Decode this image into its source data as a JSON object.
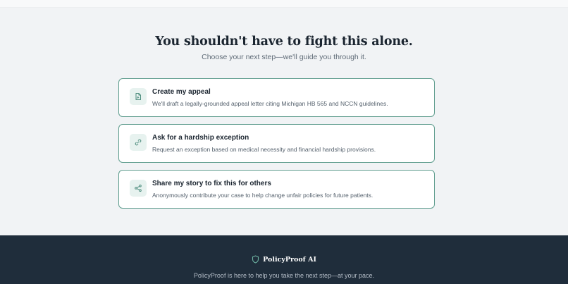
{
  "hero": {
    "headline": "You shouldn't have to fight this alone.",
    "subheadline": "Choose your next step—we'll guide you through it."
  },
  "options": [
    {
      "icon": "document-icon",
      "title": "Create my appeal",
      "description": "We'll draft a legally-grounded appeal letter citing Michigan HB 565 and NCCN guidelines."
    },
    {
      "icon": "link-icon",
      "title": "Ask for a hardship exception",
      "description": "Request an exception based on medical necessity and financial hardship provisions."
    },
    {
      "icon": "share-icon",
      "title": "Share my story to fix this for others",
      "description": "Anonymously contribute your case to help change unfair policies for future patients."
    }
  ],
  "footer": {
    "brand_name": "PolicyProof AI",
    "brand_icon": "shield-icon",
    "tagline": "PolicyProof is here to help you take the next step—at your pace."
  },
  "colors": {
    "accent": "#5f9d8e",
    "icon_bg": "#e7f2ef",
    "footer_bg": "#1f2d3b",
    "page_bg": "#f1f3f5"
  }
}
